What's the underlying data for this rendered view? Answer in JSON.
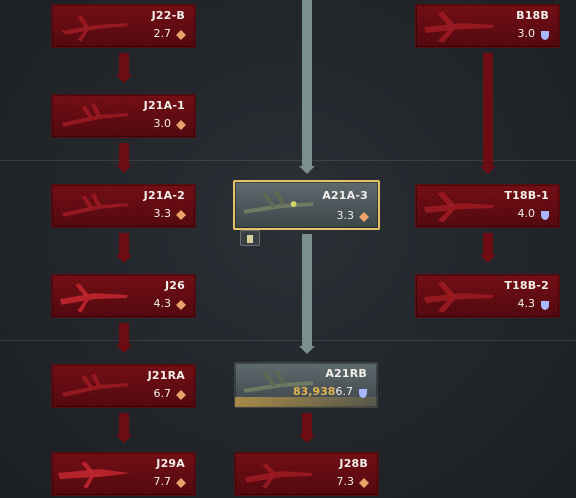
{
  "vehicles": [
    {
      "name": "J22-B",
      "br": "2.7",
      "currency": "silver-diamond-icon"
    },
    {
      "name": "J21A-1",
      "br": "3.0",
      "currency": "silver-diamond-icon"
    },
    {
      "name": "J21A-2",
      "br": "3.3",
      "currency": "silver-diamond-icon"
    },
    {
      "name": "J26",
      "br": "4.3",
      "currency": "silver-diamond-icon"
    },
    {
      "name": "J21RA",
      "br": "6.7",
      "currency": "silver-diamond-icon"
    },
    {
      "name": "J29A",
      "br": "7.7",
      "currency": "silver-diamond-icon"
    },
    {
      "name": "A21A-3",
      "br": "3.3",
      "currency": "silver-diamond-icon"
    },
    {
      "name": "A21RB",
      "br": "6.7",
      "currency": "blue-shield-icon",
      "research_cost": "83,938"
    },
    {
      "name": "J28B",
      "br": "7.3",
      "currency": "silver-diamond-icon"
    },
    {
      "name": "B18B",
      "br": "3.0",
      "currency": "blue-shield-icon"
    },
    {
      "name": "T18B-1",
      "br": "4.0",
      "currency": "blue-shield-icon"
    },
    {
      "name": "T18B-2",
      "br": "4.3",
      "currency": "blue-shield-icon"
    }
  ],
  "colors": {
    "locked_card": "#6a0d13",
    "researched_card": "#56636a",
    "selected_border": "#e7c16a",
    "line_red": "#6d0c12",
    "line_grey": "#7b8f8d",
    "silver_icon": "#e9a36a",
    "premium_icon": "#a8b8ff",
    "cost_text": "#e0b44f"
  }
}
